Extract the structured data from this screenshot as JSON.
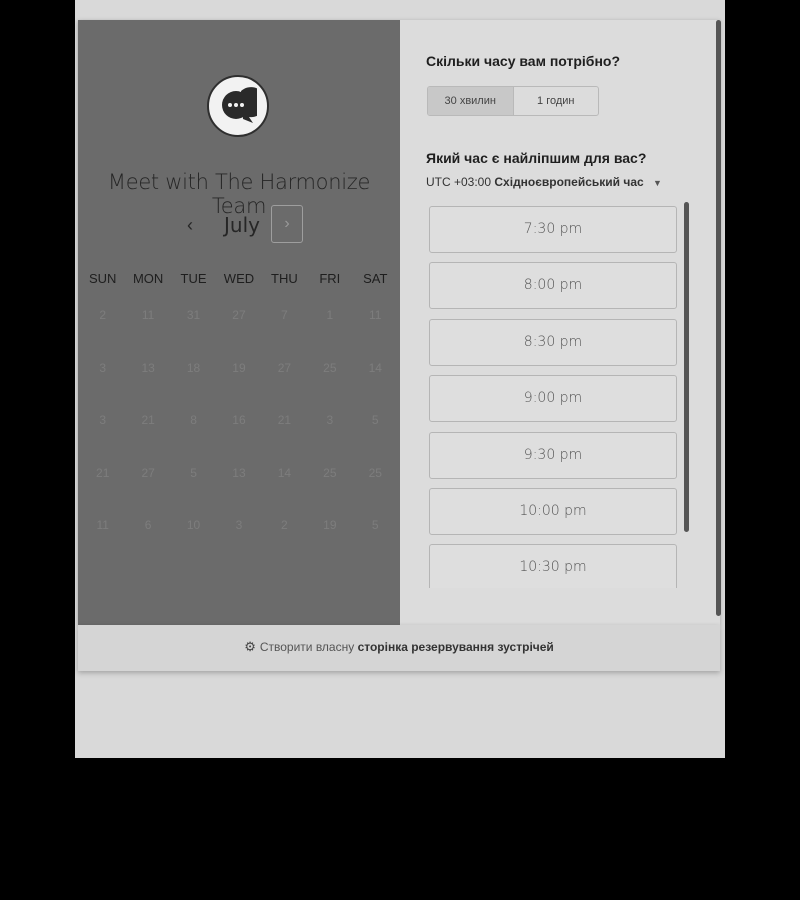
{
  "title": "Meet with The Harmonize Team",
  "calendar": {
    "month": "July",
    "prev_symbol": "‹",
    "next_symbol": "›",
    "weekdays": [
      "SUN",
      "MON",
      "TUE",
      "WED",
      "THU",
      "FRI",
      "SAT"
    ],
    "weeks": [
      [
        "2",
        "11",
        "31",
        "27",
        "7",
        "1",
        "11"
      ],
      [
        "3",
        "13",
        "18",
        "19",
        "27",
        "25",
        "14"
      ],
      [
        "3",
        "21",
        "8",
        "16",
        "21",
        "3",
        "5"
      ],
      [
        "21",
        "27",
        "5",
        "13",
        "14",
        "25",
        "25"
      ],
      [
        "11",
        "6",
        "10",
        "3",
        "2",
        "19",
        "5"
      ]
    ]
  },
  "duration": {
    "question": "Скільки часу вам потрібно?",
    "options": [
      "30 хвилин",
      "1 годин"
    ],
    "selected": "30 хвилин"
  },
  "time": {
    "question": "Який час є найліпшим для вас?",
    "timezone_offset": "UTC +03:00",
    "timezone_name": "Східноєвропейський час",
    "slots": [
      "7:30 pm",
      "8:00 pm",
      "8:30 pm",
      "9:00 pm",
      "9:30 pm",
      "10:00 pm",
      "10:30 pm"
    ]
  },
  "footer": {
    "prefix": "Створити власну",
    "link": "сторінка резервування зустрічей"
  },
  "icons": {
    "avatar": "chat-bubble-icon",
    "timezone_caret": "caret-down-icon",
    "footer": "sprocket-icon"
  }
}
